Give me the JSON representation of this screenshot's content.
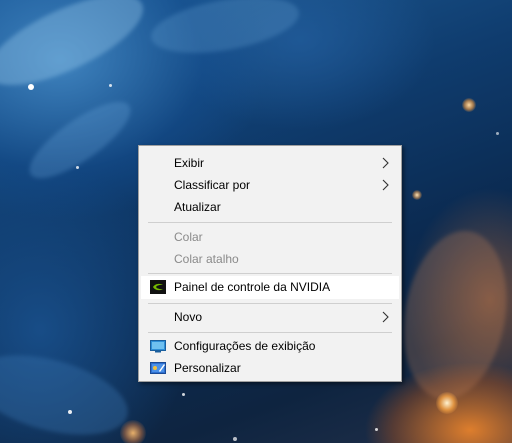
{
  "context_menu": {
    "items": [
      {
        "label": "Exibir",
        "has_submenu": true,
        "enabled": true
      },
      {
        "label": "Classificar por",
        "has_submenu": true,
        "enabled": true
      },
      {
        "label": "Atualizar",
        "has_submenu": false,
        "enabled": true
      },
      {
        "label": "Colar",
        "has_submenu": false,
        "enabled": false
      },
      {
        "label": "Colar atalho",
        "has_submenu": false,
        "enabled": false
      },
      {
        "label": "Painel de controle da NVIDIA",
        "has_submenu": false,
        "enabled": true,
        "icon": "nvidia-icon",
        "highlighted": true
      },
      {
        "label": "Novo",
        "has_submenu": true,
        "enabled": true
      },
      {
        "label": "Configurações de exibição",
        "has_submenu": false,
        "enabled": true,
        "icon": "display-settings-icon"
      },
      {
        "label": "Personalizar",
        "has_submenu": false,
        "enabled": true,
        "icon": "personalize-icon"
      }
    ]
  },
  "colors": {
    "menu_background": "#f2f2f2",
    "menu_border": "#a0a0a0",
    "disabled_text": "#8a8a8a",
    "highlight_background": "#ffffff",
    "nvidia_green": "#76b900"
  }
}
